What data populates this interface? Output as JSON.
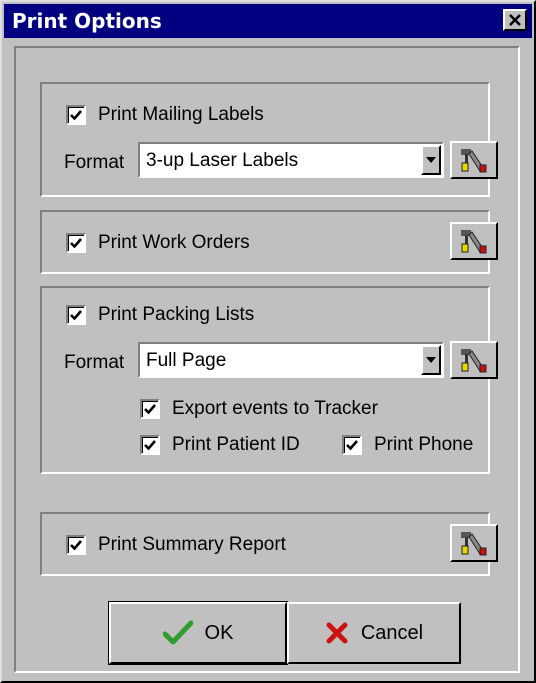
{
  "window": {
    "title": "Print Options",
    "close_label": "✕"
  },
  "mailing_labels": {
    "checkbox_label": "Print Mailing Labels",
    "checked": true,
    "format_label": "Format",
    "format_value": "3-up Laser Labels"
  },
  "work_orders": {
    "checkbox_label": "Print Work Orders",
    "checked": true
  },
  "packing_lists": {
    "checkbox_label": "Print Packing Lists",
    "checked": true,
    "format_label": "Format",
    "format_value": "Full Page",
    "export_label": "Export events to Tracker",
    "patient_id_label": "Print Patient ID",
    "phone_label": "Print Phone"
  },
  "summary_report": {
    "checkbox_label": "Print Summary Report",
    "checked": true
  },
  "buttons": {
    "ok_label": "OK",
    "cancel_label": "Cancel"
  },
  "icons": {
    "setup": "tools-setup-icon",
    "ok": "green-check-icon",
    "cancel": "red-x-icon"
  },
  "colors": {
    "titlebar": "#000080",
    "face": "#c0c0c0",
    "ok_check": "#2e9c2e",
    "cancel_x": "#cc1111"
  }
}
